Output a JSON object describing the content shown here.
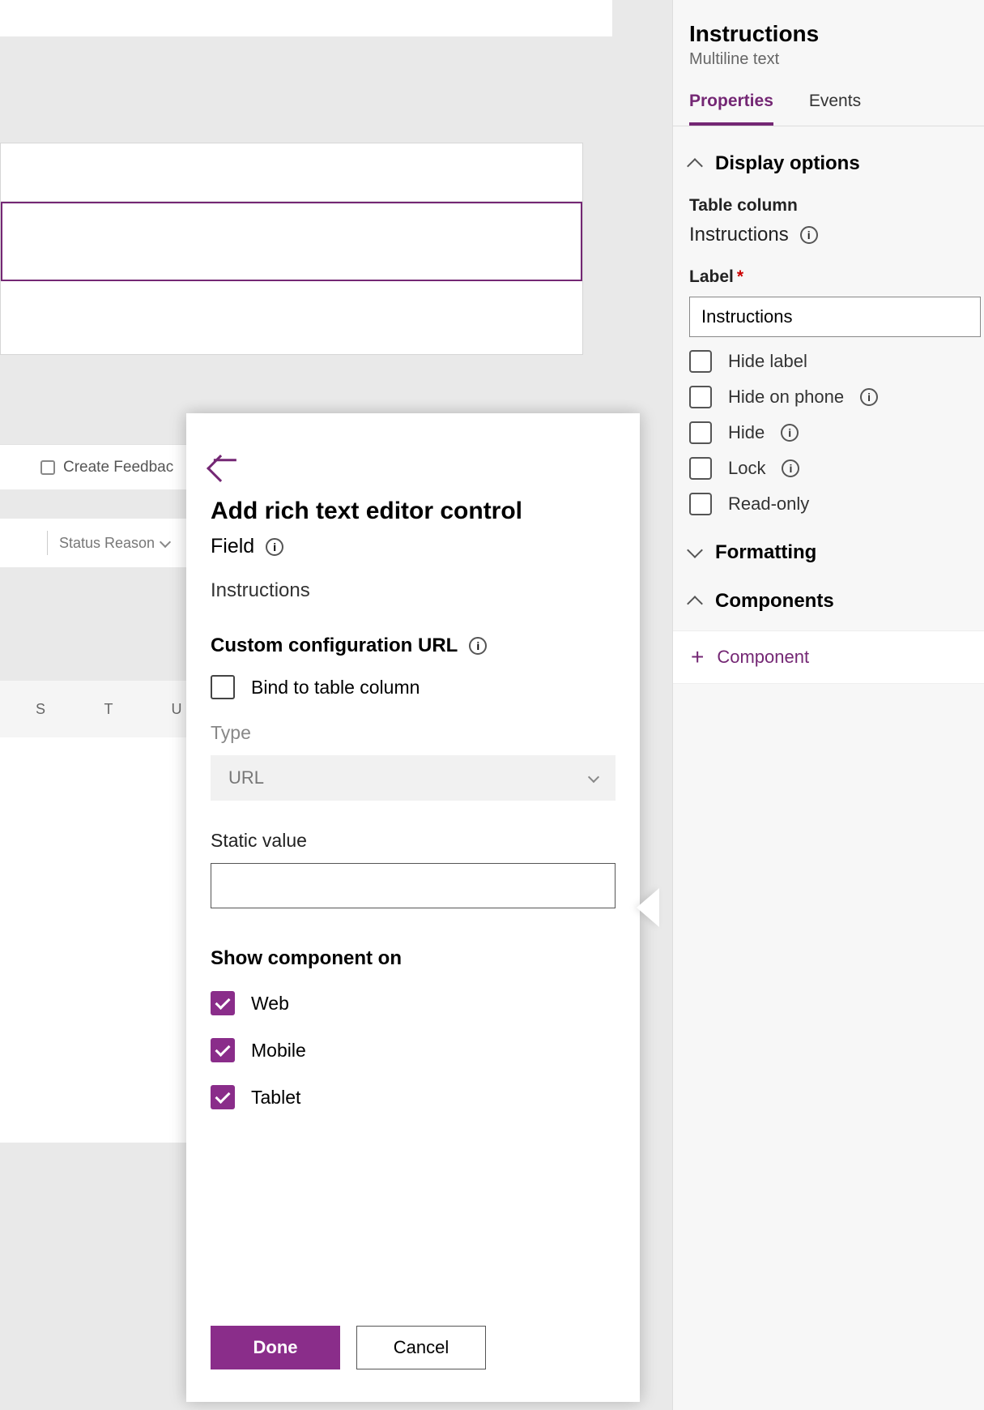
{
  "canvas": {
    "toolbar_item": "Create Feedbac",
    "status_label": "Status Reason",
    "grid_cols": [
      "S",
      "T",
      "U"
    ]
  },
  "right": {
    "title": "Instructions",
    "subtitle": "Multiline text",
    "tabs": {
      "properties": "Properties",
      "events": "Events"
    },
    "sections": {
      "display": "Display options",
      "formatting": "Formatting",
      "components": "Components"
    },
    "table_column_label": "Table column",
    "table_column_value": "Instructions",
    "label_label": "Label",
    "label_value": "Instructions",
    "checks": {
      "hide_label": "Hide label",
      "hide_on_phone": "Hide on phone",
      "hide": "Hide",
      "lock": "Lock",
      "read_only": "Read-only"
    },
    "add_component": "Component"
  },
  "modal": {
    "title": "Add rich text editor control",
    "field_label": "Field",
    "field_value": "Instructions",
    "config_header": "Custom configuration URL",
    "bind_check": "Bind to table column",
    "type_label": "Type",
    "type_value": "URL",
    "static_label": "Static value",
    "static_value": "",
    "show_header": "Show component on",
    "platforms": {
      "web": "Web",
      "mobile": "Mobile",
      "tablet": "Tablet"
    },
    "done": "Done",
    "cancel": "Cancel"
  }
}
